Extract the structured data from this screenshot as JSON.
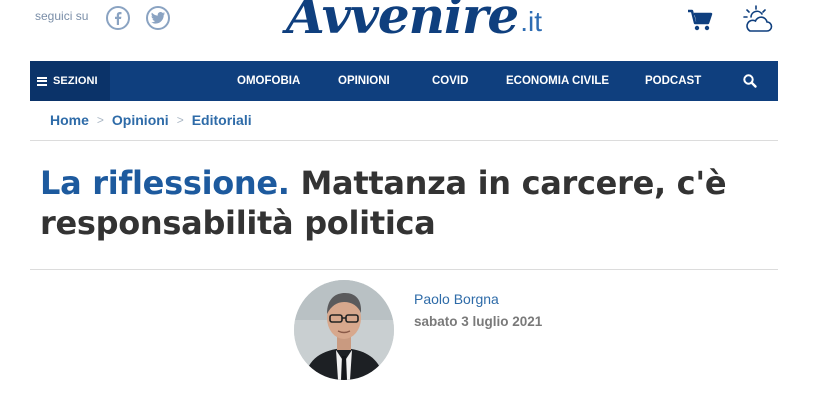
{
  "header": {
    "follow_label": "seguici su",
    "logo_main": "Avvenire",
    "logo_suffix": ".it",
    "icons": [
      "facebook-icon",
      "twitter-icon",
      "cart-icon",
      "weather-icon"
    ]
  },
  "nav": {
    "sections_label": "SEZIONI",
    "items": [
      "OMOFOBIA",
      "OPINIONI",
      "COVID",
      "ECONOMIA CIVILE",
      "PODCAST"
    ],
    "colors": {
      "bar": "#0f3f7e",
      "sections_bg": "#0b3369"
    }
  },
  "breadcrumb": [
    "Home",
    "Opinioni",
    "Editoriali"
  ],
  "article": {
    "kicker": "La riflessione.",
    "headline": "Mattanza in carcere, c'è responsabilità politica",
    "author": "Paolo Borgna",
    "date": "sabato 3 luglio 2021"
  }
}
